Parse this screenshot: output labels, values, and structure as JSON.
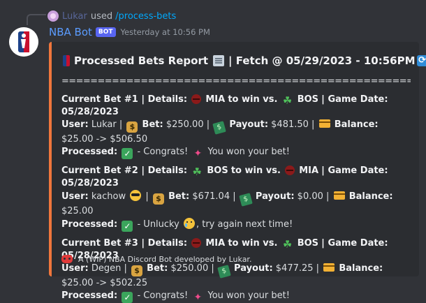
{
  "reply": {
    "user": "Lukar",
    "verb": "used",
    "command": "/process-bets"
  },
  "message": {
    "author": "NBA Bot",
    "tag": "BOT",
    "timestamp": "Yesterday at 10:56 PM"
  },
  "embed": {
    "accent_color": "#f0763c",
    "title_part1": "Processed Bets Report",
    "title_part2": "| Fetch @ 05/29/2023 - 10:56PM",
    "separator": "========================================================",
    "bets": [
      {
        "header_prefix": "Current Bet #1 | Details:",
        "team1": "MIA",
        "middle": "to win vs.",
        "team2": "BOS",
        "game_date": "| Game Date: 05/28/2023",
        "user_label": "User:",
        "user": "Lukar |",
        "bet_label": "Bet:",
        "bet": "$250.00 |",
        "payout_label": "Payout:",
        "payout": "$481.50 |",
        "balance_label": "Balance:",
        "balance": "$25.00 -> $506.50",
        "processed_label": "Processed:",
        "result_pre": "- Congrats!",
        "result_post": "You won your bet!"
      },
      {
        "header_prefix": "Current Bet #2 | Details:",
        "team1": "BOS",
        "middle": "to win vs.",
        "team2": "MIA",
        "game_date": "| Game Date: 05/28/2023",
        "user_label": "User:",
        "user": "kachow",
        "bet_label": "Bet:",
        "bet": "$671.04 |",
        "payout_label": "Payout:",
        "payout": "$0.00 |",
        "balance_label": "Balance:",
        "balance": "$25.00",
        "processed_label": "Processed:",
        "result_pre": "- Unlucky",
        "result_post": ", try again next time!"
      },
      {
        "header_prefix": "Current Bet #3 | Details:",
        "team1": "MIA",
        "middle": "to win vs.",
        "team2": "BOS",
        "game_date": "| Game Date: 05/28/2023",
        "user_label": "User:",
        "user": "Degen |",
        "bet_label": "Bet:",
        "bet": "$250.00 |",
        "payout_label": "Payout:",
        "payout": "$477.25 |",
        "balance_label": "Balance:",
        "balance": "$25.00 -> $502.25",
        "processed_label": "Processed:",
        "result_pre": "- Congrats!",
        "result_post": "You won your bet!"
      }
    ],
    "footer": "A (WIP) NBA Discord Bot developed by Lukar."
  },
  "icons": {
    "nba_logo": "nba-logo-icon",
    "newspaper": "newspaper-icon",
    "refresh": "refresh-icon",
    "heat": "basketball-icon",
    "celtics": "clover-icon",
    "money": "money-bag-icon",
    "payout": "flying-money-icon",
    "balance": "credit-card-icon",
    "check": "check-mark-icon",
    "party": "party-popper-icon",
    "cool": "sunglasses-face-icon",
    "cry": "crying-face-icon",
    "discord": "discord-icon"
  }
}
